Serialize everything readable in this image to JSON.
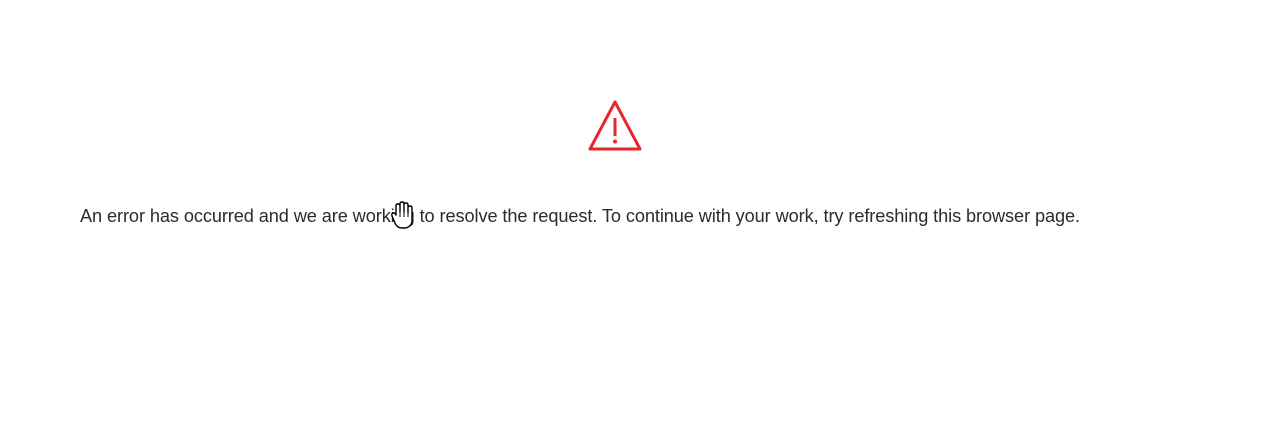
{
  "error": {
    "icon": "warning-triangle-icon",
    "icon_color": "#e8262b",
    "message": "An error has occurred and we are working to resolve the request. To continue with your work, try refreshing this browser page."
  },
  "cursor": {
    "icon": "hand-cursor-icon"
  }
}
